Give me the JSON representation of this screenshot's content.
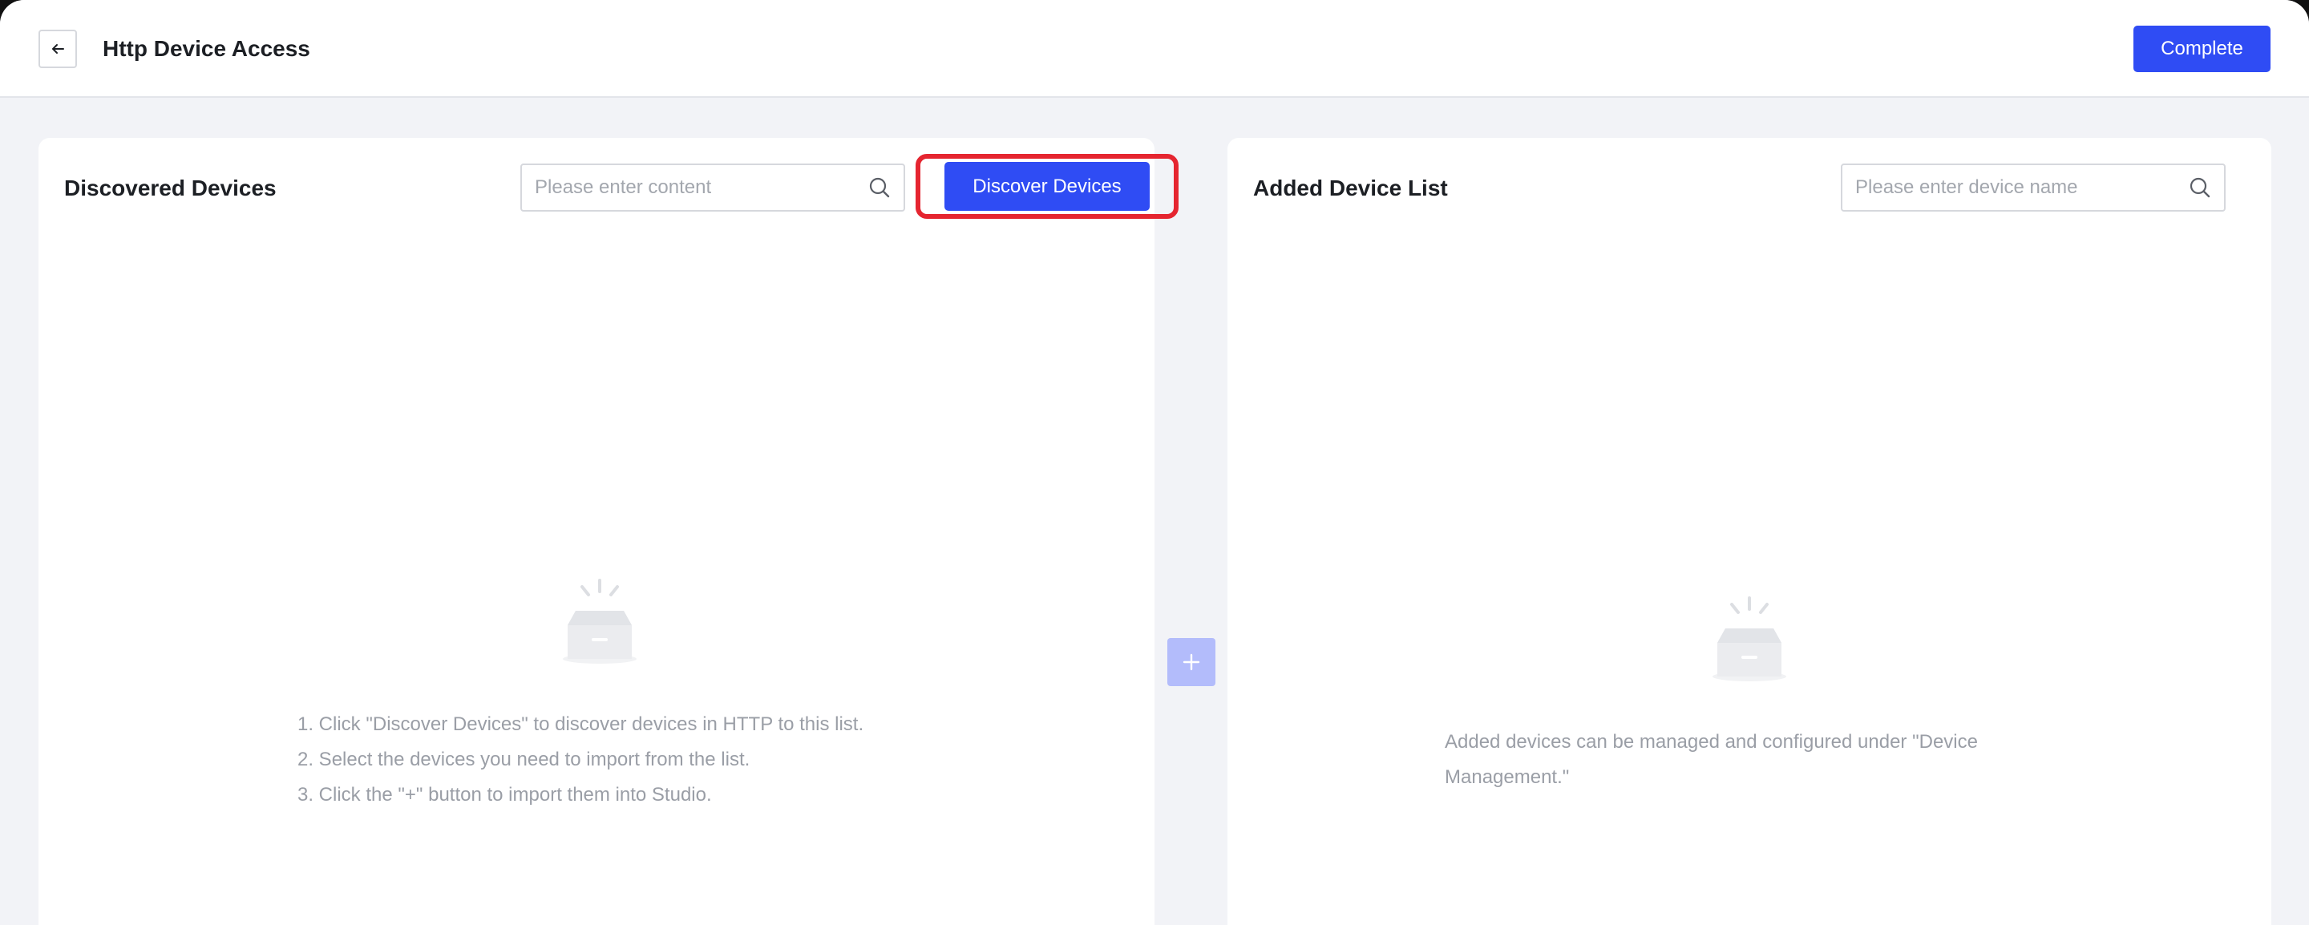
{
  "header": {
    "title": "Http Device Access",
    "complete_label": "Complete",
    "back_icon": "arrow-left-icon"
  },
  "discovered": {
    "title": "Discovered Devices",
    "search_placeholder": "Please enter content",
    "discover_label": "Discover Devices",
    "empty_icon": "empty-box-icon",
    "instructions": [
      "1. Click \"Discover Devices\" to discover devices in HTTP to this list.",
      "2. Select the devices you need to import from the list.",
      "3. Click the \"+\" button to import them into Studio."
    ]
  },
  "added": {
    "title": "Added Device List",
    "search_placeholder": "Please enter device name",
    "empty_icon": "empty-box-icon",
    "note": "Added devices can be managed and configured under \"Device Management.\""
  },
  "transfer": {
    "add_icon": "plus-icon"
  },
  "colors": {
    "accent": "#2f4cf4",
    "accent_disabled": "#b3bcfb",
    "highlight_border": "#e52530",
    "background": "#f2f3f7"
  }
}
